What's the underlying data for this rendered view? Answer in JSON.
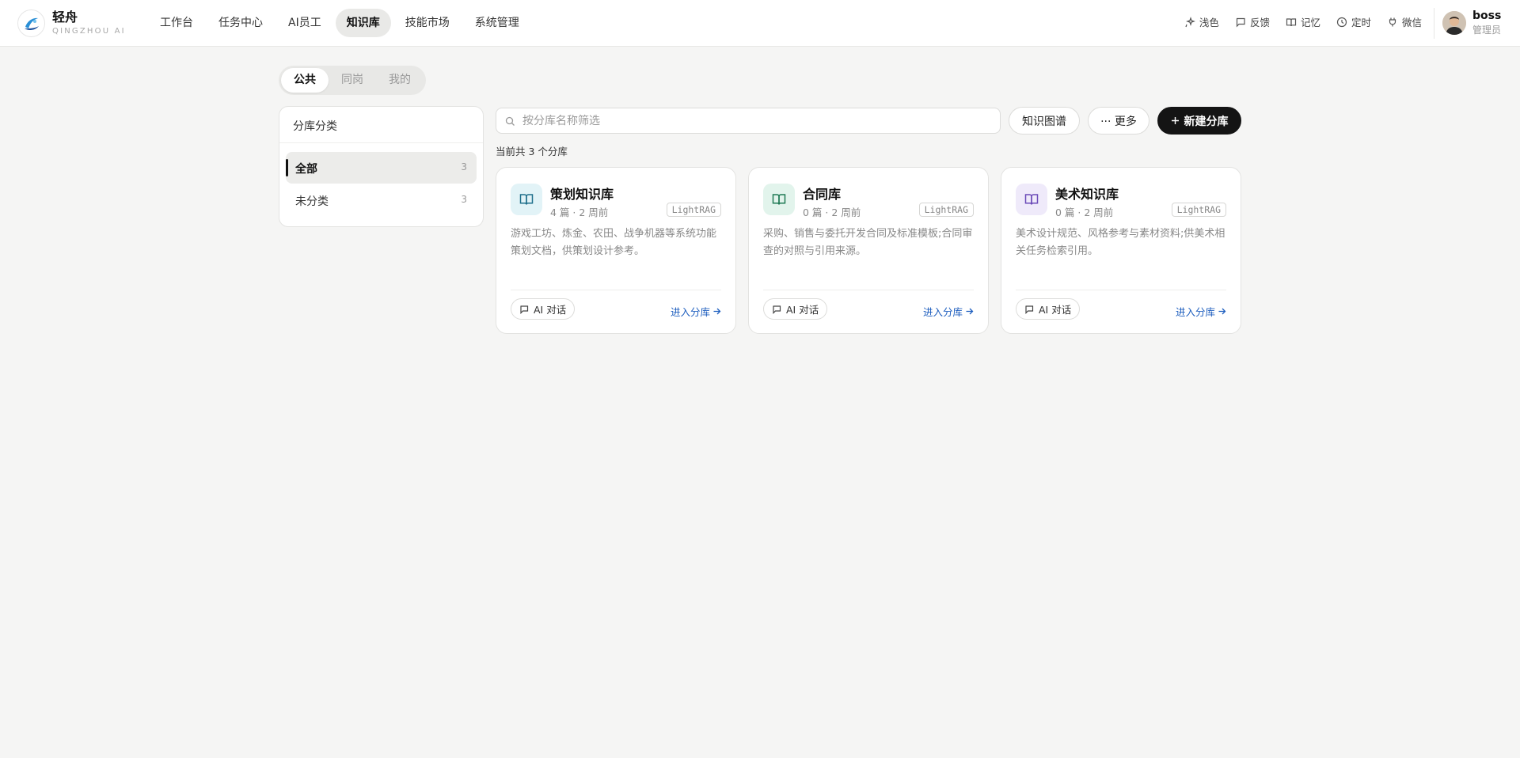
{
  "app": {
    "name": "轻舟",
    "subtitle": "QINGZHOU AI"
  },
  "nav": {
    "items": [
      {
        "label": "工作台",
        "active": false
      },
      {
        "label": "任务中心",
        "active": false
      },
      {
        "label": "AI员工",
        "active": false
      },
      {
        "label": "知识库",
        "active": true
      },
      {
        "label": "技能市场",
        "active": false
      },
      {
        "label": "系统管理",
        "active": false
      }
    ]
  },
  "tools": [
    {
      "label": "浅色",
      "icon": "sparkle-icon"
    },
    {
      "label": "反馈",
      "icon": "message-icon"
    },
    {
      "label": "记忆",
      "icon": "book-icon"
    },
    {
      "label": "定时",
      "icon": "clock-icon"
    },
    {
      "label": "微信",
      "icon": "plug-icon"
    }
  ],
  "user": {
    "name": "boss",
    "role": "管理员"
  },
  "scope_tabs": [
    {
      "label": "公共",
      "active": true
    },
    {
      "label": "同岗",
      "active": false
    },
    {
      "label": "我的",
      "active": false
    }
  ],
  "sidebar": {
    "title": "分库分类",
    "categories": [
      {
        "label": "全部",
        "count": "3",
        "active": true
      },
      {
        "label": "未分类",
        "count": "3",
        "active": false
      }
    ]
  },
  "toolbar": {
    "search_placeholder": "按分库名称筛选",
    "graph_label": "知识图谱",
    "more_label": "··· 更多",
    "new_label": "新建分库"
  },
  "summary": "当前共 3 个分库",
  "libraries": [
    {
      "title": "策划知识库",
      "meta": "4 篇 · 2 周前",
      "engine": "LightRAG",
      "desc": "游戏工坊、炼金、农田、战争机器等系统功能策划文档，供策划设计参考。",
      "icon_color": "#1f6f8b",
      "icon_bg": "#e2f3f7",
      "chat_label": "AI 对话",
      "enter_label": "进入分库"
    },
    {
      "title": "合同库",
      "meta": "0 篇 · 2 周前",
      "engine": "LightRAG",
      "desc": "采购、销售与委托开发合同及标准模板;合同审查的对照与引用来源。",
      "icon_color": "#1f7a55",
      "icon_bg": "#e2f4ec",
      "chat_label": "AI 对话",
      "enter_label": "进入分库"
    },
    {
      "title": "美术知识库",
      "meta": "0 篇 · 2 周前",
      "engine": "LightRAG",
      "desc": "美术设计规范、风格参考与素材资料;供美术相关任务检索引用。",
      "icon_color": "#6b4bb8",
      "icon_bg": "#efeafa",
      "chat_label": "AI 对话",
      "enter_label": "进入分库"
    }
  ]
}
